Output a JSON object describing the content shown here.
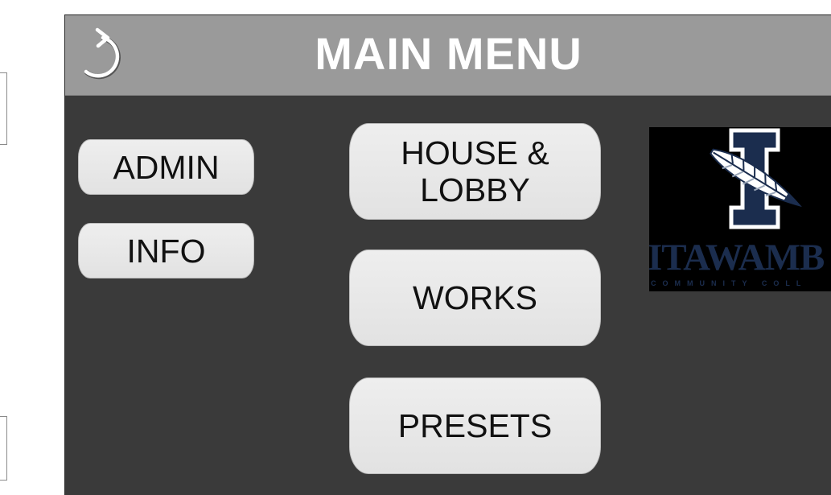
{
  "header": {
    "title": "MAIN MENU",
    "back_icon": "undo-arrow-icon"
  },
  "menu": {
    "admin_label": "ADMIN",
    "info_label": "INFO",
    "house_lobby_line1": "HOUSE &",
    "house_lobby_line2": "LOBBY",
    "works_label": "WORKS",
    "presets_label": "PRESETS"
  },
  "logo": {
    "letter": "I",
    "name": "ITAWAMB",
    "subtitle": "COMMUNITY COLL"
  },
  "colors": {
    "panel_bg": "#3a3a3a",
    "header_bg": "#9a9a9a",
    "button_bg": "#e6e6e6",
    "logo_navy": "#1b2d4e"
  }
}
